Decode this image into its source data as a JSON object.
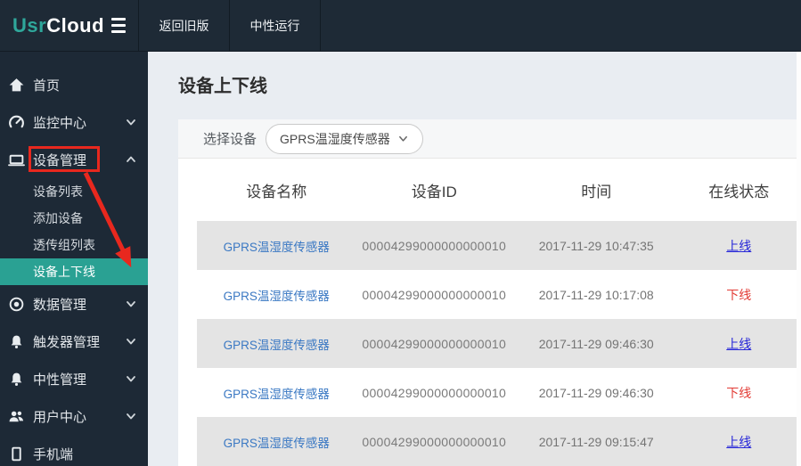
{
  "topbar": {
    "logo": {
      "part1": "Usr",
      "part2": "Cloud"
    },
    "menu": [
      {
        "label": "返回旧版"
      },
      {
        "label": "中性运行"
      }
    ]
  },
  "sidebar": {
    "items": [
      {
        "label": "首页",
        "icon": "home-icon",
        "chevron": null
      },
      {
        "label": "监控中心",
        "icon": "gauge-icon",
        "chevron": "down"
      },
      {
        "label": "设备管理",
        "icon": "laptop-icon",
        "chevron": "up",
        "annotated": true
      },
      {
        "label": "数据管理",
        "icon": "target-icon",
        "chevron": "down"
      },
      {
        "label": "触发器管理",
        "icon": "bell-icon",
        "chevron": "down"
      },
      {
        "label": "中性管理",
        "icon": "bell-icon",
        "chevron": "down"
      },
      {
        "label": "用户中心",
        "icon": "users-icon",
        "chevron": "down"
      },
      {
        "label": "手机端",
        "icon": "phone-icon",
        "chevron": null
      }
    ],
    "device_submenu": [
      {
        "label": "设备列表",
        "selected": false
      },
      {
        "label": "添加设备",
        "selected": false
      },
      {
        "label": "透传组列表",
        "selected": false
      },
      {
        "label": "设备上下线",
        "selected": true
      }
    ]
  },
  "main": {
    "page_title": "设备上下线",
    "filter": {
      "label": "选择设备",
      "selected_value": "GPRS温湿度传感器"
    },
    "table": {
      "columns": [
        "设备名称",
        "设备ID",
        "时间",
        "在线状态"
      ],
      "rows": [
        {
          "name": "GPRS温湿度传感器",
          "id": "00004299000000000010",
          "time": "2017-11-29 10:47:35",
          "status": "上线",
          "status_type": "online"
        },
        {
          "name": "GPRS温湿度传感器",
          "id": "00004299000000000010",
          "time": "2017-11-29 10:17:08",
          "status": "下线",
          "status_type": "offline"
        },
        {
          "name": "GPRS温湿度传感器",
          "id": "00004299000000000010",
          "time": "2017-11-29 09:46:30",
          "status": "上线",
          "status_type": "online"
        },
        {
          "name": "GPRS温湿度传感器",
          "id": "00004299000000000010",
          "time": "2017-11-29 09:46:30",
          "status": "下线",
          "status_type": "offline"
        },
        {
          "name": "GPRS温湿度传感器",
          "id": "00004299000000000010",
          "time": "2017-11-29 09:15:47",
          "status": "上线",
          "status_type": "online"
        }
      ]
    }
  },
  "colors": {
    "topbar_bg": "#1e2a36",
    "sidebar_bg": "#1d2936",
    "accent_teal": "#2aa193",
    "logo_teal": "#2fa79b",
    "page_bg": "#e9edf2",
    "row_stripe": "#e4e4e4",
    "device_link_blue": "#3a78c3",
    "online_blue": "#2626d8",
    "offline_red": "#e23b35",
    "annotation_red": "#e8281e"
  }
}
